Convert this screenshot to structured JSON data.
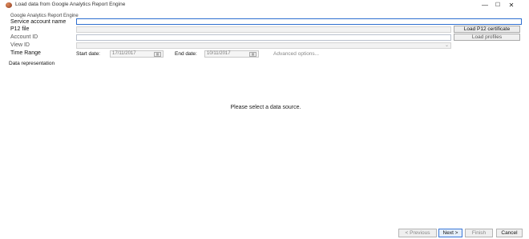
{
  "window": {
    "title": "Load data from Google Analytics Report Engine",
    "minimize": "—",
    "maximize": "☐",
    "close": "✕"
  },
  "page": {
    "title": "Google Analytics Report Engine"
  },
  "form": {
    "service_account_label": "Service account name",
    "service_account_value": "",
    "p12_label": "P12 file",
    "p12_value": "",
    "load_p12_button": "Load P12 certificate",
    "account_id_label": "Account ID",
    "account_id_value": "",
    "load_profiles_button": "Load profiles",
    "view_id_label": "View ID",
    "view_id_value": "",
    "time_range_label": "Time Range",
    "start_date_label": "Start date:",
    "start_date_value": "17/11/2017",
    "end_date_label": "End date:",
    "end_date_value": "10/11/2017",
    "advanced_options_link": "Advanced options..."
  },
  "data_representation": {
    "label": "Data representation",
    "message": "Please select a data source."
  },
  "footer": {
    "previous_button": "< Previous",
    "next_button": "Next >",
    "finish_button": "Finish",
    "cancel_button": "Cancel"
  },
  "colors": {
    "accent": "#2f6fd0",
    "default_button": "#3b78d8"
  }
}
